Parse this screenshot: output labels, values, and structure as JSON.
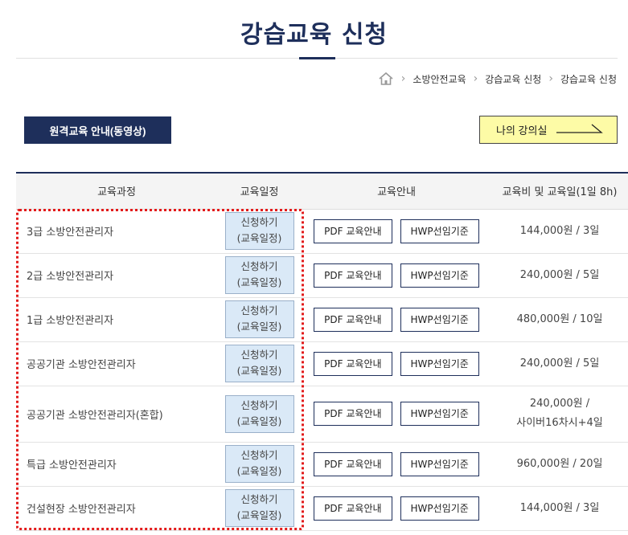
{
  "page": {
    "title": "강습교육 신청"
  },
  "breadcrumb": {
    "home_icon": "home-icon",
    "items": [
      "소방안전교육",
      "강습교육 신청",
      "강습교육 신청"
    ]
  },
  "buttons": {
    "remote": "원격교육 안내(동영상)",
    "my_room": "나의 강의실"
  },
  "table": {
    "headers": [
      "교육과정",
      "교육일정",
      "교육안내",
      "교육비 및 교육일(1일 8h)"
    ],
    "sched_label_1": "신청하기",
    "sched_label_2": "(교육일정)",
    "pdf_label": "PDF 교육안내",
    "hwp_label": "HWP선임기준",
    "rows": [
      {
        "course": "3급 소방안전관리자",
        "fee": "144,000원 / 3일",
        "fee2": ""
      },
      {
        "course": "2급 소방안전관리자",
        "fee": "240,000원 / 5일",
        "fee2": ""
      },
      {
        "course": "1급 소방안전관리자",
        "fee": "480,000원 / 10일",
        "fee2": ""
      },
      {
        "course": "공공기관 소방안전관리자",
        "fee": "240,000원 / 5일",
        "fee2": ""
      },
      {
        "course": "공공기관 소방안전관리자(혼합)",
        "fee": "240,000원 /",
        "fee2": "사이버16차시+4일"
      },
      {
        "course": "특급 소방안전관리자",
        "fee": "960,000원 / 20일",
        "fee2": ""
      },
      {
        "course": "건설현장 소방안전관리자",
        "fee": "144,000원 / 3일",
        "fee2": ""
      }
    ]
  },
  "colors": {
    "navy": "#1e2f5b",
    "highlight_red": "#e21b1b",
    "yellow": "#fdfba6",
    "sched_blue": "#dae9f7"
  }
}
